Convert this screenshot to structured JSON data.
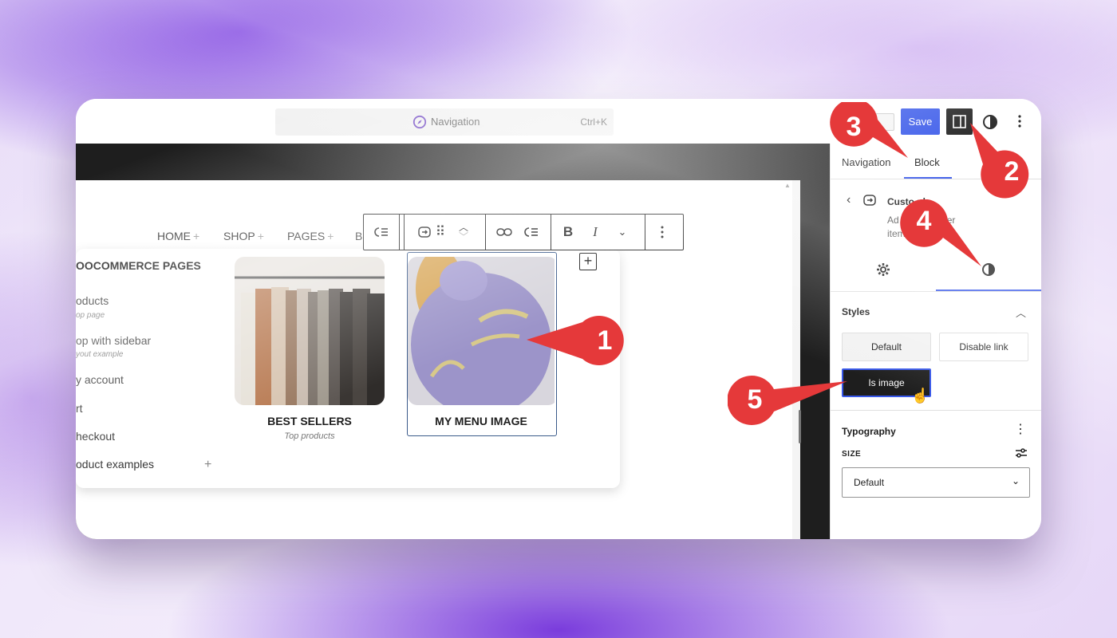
{
  "topbar": {
    "command_label": "Navigation",
    "command_shortcut": "Ctrl+K",
    "save_label": "Save",
    "icons": [
      "compass-icon",
      "sidebar-toggle-icon",
      "half-circle-icon",
      "more-vertical-icon"
    ]
  },
  "canvas": {
    "nav_items": [
      {
        "label": "HOME",
        "has_plus": true
      },
      {
        "label": "SHOP",
        "has_plus": true
      },
      {
        "label": "PAGES",
        "has_plus": true
      },
      {
        "label": "B",
        "has_plus": false
      }
    ],
    "toolbar_buttons": [
      "B",
      "I"
    ],
    "add_block_label": "+",
    "menu_column": {
      "heading": "OOCOMMERCE PAGES",
      "links": [
        {
          "label": "oducts",
          "desc": "op page"
        },
        {
          "label": "op with sidebar",
          "desc": "yout example"
        },
        {
          "label": "y account",
          "desc": ""
        },
        {
          "label": "rt",
          "desc": ""
        },
        {
          "label": "heckout",
          "desc": ""
        },
        {
          "label": "oduct examples",
          "desc": ""
        }
      ],
      "plus": "+"
    },
    "cards": [
      {
        "title": "BEST SELLERS",
        "subtitle": "Top products"
      },
      {
        "title": "MY MENU IMAGE",
        "subtitle": ""
      }
    ]
  },
  "sidebar": {
    "tabs": [
      "Navigation",
      "Block"
    ],
    "active_tab": "Block",
    "block_title": "Custom Link",
    "block_title_visible": "Custo      nk",
    "block_desc_line1": "Ad          k, or another",
    "block_desc_line2": "item        igation.",
    "styles_title": "Styles",
    "style_options": [
      "Default",
      "Disable link",
      "Is image"
    ],
    "active_style": "Is image",
    "typography_title": "Typography",
    "size_label": "SIZE",
    "size_value": "Default"
  },
  "callouts": [
    "1",
    "2",
    "3",
    "4",
    "5"
  ],
  "colors": {
    "accent": "#3858e9",
    "callout_red": "#e5393a",
    "dark": "#1e1e1e"
  }
}
